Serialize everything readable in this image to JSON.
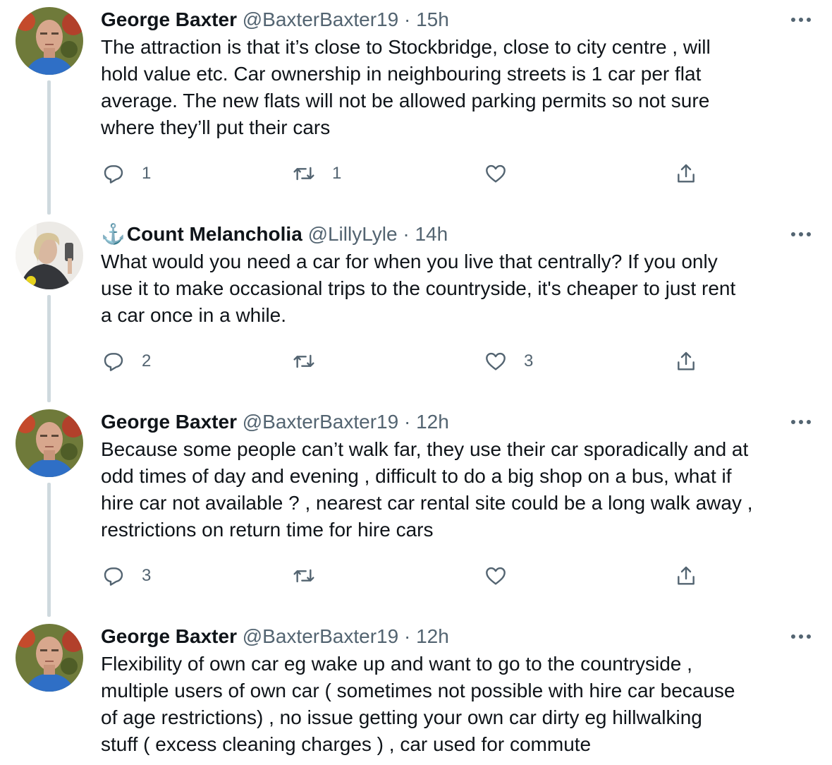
{
  "tweets": [
    {
      "name": "George Baxter",
      "name_prefix": "",
      "handle": "@BaxterBaxter19",
      "separator": "·",
      "time": "15h",
      "lines": [
        "The attraction is that it’s close to Stockbridge, close to city centre , will",
        "hold value etc. Car ownership in neighbouring streets is 1 car per flat",
        "average. The new flats will not be allowed parking permits so not sure",
        "where they’ll put their cars"
      ],
      "reply_count": "1",
      "retweet_count": "1",
      "like_count": ""
    },
    {
      "name": "Count Melancholia",
      "name_prefix": "⚓",
      "handle": "@LillyLyle",
      "separator": "·",
      "time": "14h",
      "lines": [
        "What would you need a car for when you live that centrally? If you only",
        "use it to make occasional trips to the countryside, it's cheaper to just rent",
        "a car once in a while."
      ],
      "reply_count": "2",
      "retweet_count": "",
      "like_count": "3"
    },
    {
      "name": "George Baxter",
      "name_prefix": "",
      "handle": "@BaxterBaxter19",
      "separator": "·",
      "time": "12h",
      "lines": [
        "Because some people can’t walk far, they use their car sporadically and at",
        "odd times of day and evening , difficult to do a big shop on a bus, what if",
        "hire car not available ? , nearest car rental site could be a long walk away ,",
        "restrictions on return time for hire cars"
      ],
      "reply_count": "3",
      "retweet_count": "",
      "like_count": ""
    },
    {
      "name": "George Baxter",
      "name_prefix": "",
      "handle": "@BaxterBaxter19",
      "separator": "·",
      "time": "12h",
      "lines": [
        "Flexibility of own car eg wake up and want to go to the countryside ,",
        "multiple users of own car ( sometimes not possible with hire car because",
        "of age restrictions) , no issue getting your own car dirty eg hillwalking",
        "stuff ( excess cleaning charges ) , car used for commute"
      ],
      "reply_count": "",
      "retweet_count": "",
      "like_count": ""
    }
  ],
  "icons": {
    "reply": "reply-icon",
    "retweet": "retweet-icon",
    "like": "heart-icon",
    "share": "share-icon",
    "more": "more-icon"
  },
  "colors": {
    "text": "#0f1419",
    "muted": "#536471",
    "thread_line": "#cfd9de",
    "anchor": "#1d6fb8"
  }
}
